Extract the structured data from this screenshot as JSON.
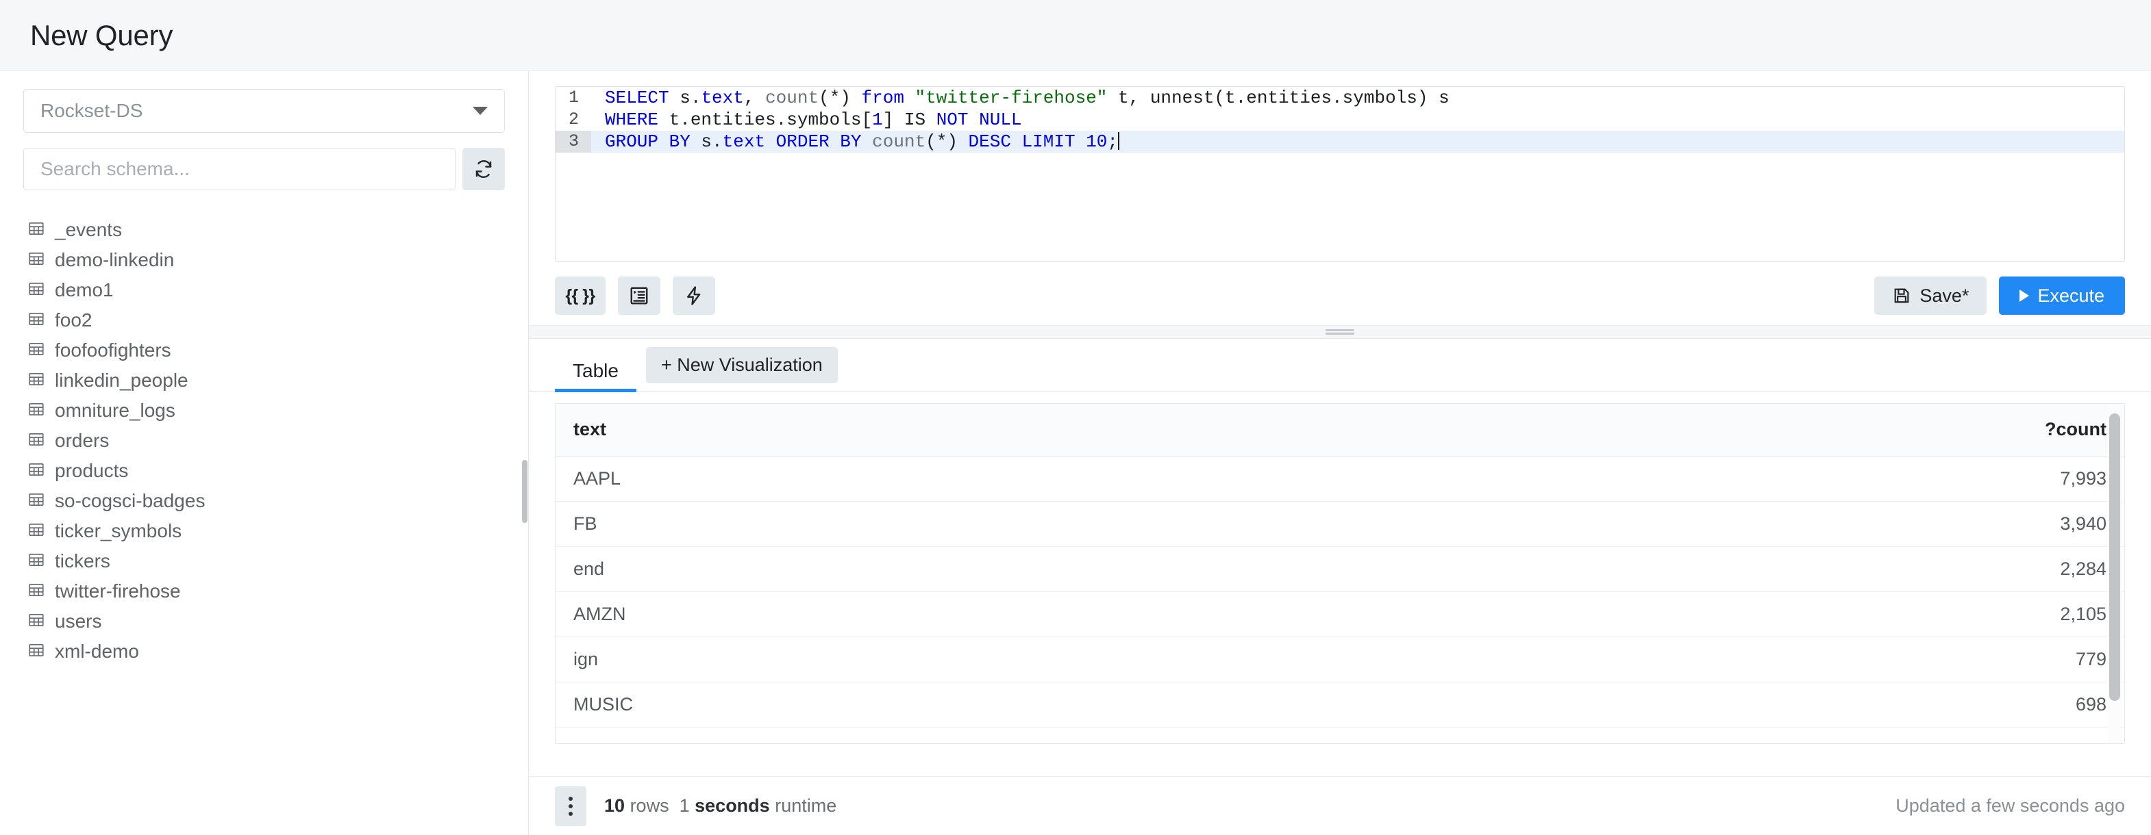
{
  "header": {
    "title": "New Query"
  },
  "sidebar": {
    "datasource": {
      "label": "Rockset-DS",
      "caret_icon": "chevron-down-icon"
    },
    "search": {
      "placeholder": "Search schema...",
      "value": ""
    },
    "refresh_icon": "refresh-icon",
    "collections": [
      {
        "name": "_events",
        "icon": "table-icon"
      },
      {
        "name": "demo-linkedin",
        "icon": "table-icon"
      },
      {
        "name": "demo1",
        "icon": "table-icon"
      },
      {
        "name": "foo2",
        "icon": "table-icon"
      },
      {
        "name": "foofoofighters",
        "icon": "table-icon"
      },
      {
        "name": "linkedin_people",
        "icon": "table-icon"
      },
      {
        "name": "omniture_logs",
        "icon": "table-icon"
      },
      {
        "name": "orders",
        "icon": "table-icon"
      },
      {
        "name": "products",
        "icon": "table-icon"
      },
      {
        "name": "so-cogsci-badges",
        "icon": "table-icon"
      },
      {
        "name": "ticker_symbols",
        "icon": "table-icon"
      },
      {
        "name": "tickers",
        "icon": "table-icon"
      },
      {
        "name": "twitter-firehose",
        "icon": "table-icon"
      },
      {
        "name": "users",
        "icon": "table-icon"
      },
      {
        "name": "xml-demo",
        "icon": "table-icon"
      }
    ]
  },
  "editor": {
    "lines": [
      {
        "number": "1",
        "active": false
      },
      {
        "number": "2",
        "active": false
      },
      {
        "number": "3",
        "active": true
      }
    ],
    "sql_text": "SELECT s.text, count(*) from \"twitter-firehose\" t, unnest(t.entities.symbols) s\nWHERE t.entities.symbols[1] IS NOT NULL\nGROUP BY s.text ORDER BY count(*) DESC LIMIT 10;",
    "line1": {
      "kw_select": "SELECT",
      "plain_a": " s.",
      "kw_text": "text",
      "plain_b": ", ",
      "fn_count": "count",
      "plain_c": "(*) ",
      "kw_from": "from",
      "plain_d": " ",
      "str_table": "\"twitter-firehose\"",
      "plain_e": " t, unnest(t.entities.symbols) s"
    },
    "line2": {
      "kw_where": "WHERE",
      "plain_a": " t.entities.symbols[",
      "num_1": "1",
      "plain_b": "] IS ",
      "kw_notnull": "NOT NULL"
    },
    "line3": {
      "kw_groupby": "GROUP BY",
      "plain_a": " s.",
      "kw_text": "text",
      "plain_b": " ",
      "kw_orderby": "ORDER BY",
      "plain_c": " ",
      "fn_count": "count",
      "plain_d": "(*) ",
      "kw_desc": "DESC",
      "plain_e": " ",
      "kw_limit": "LIMIT",
      "plain_f": " ",
      "num_10": "10",
      "plain_g": ";"
    }
  },
  "toolbar": {
    "params_label": "{{ }}",
    "params_icon": "curly-braces-icon",
    "format_icon": "indent-format-icon",
    "lightning_icon": "lightning-bolt-icon",
    "save_label": "Save*",
    "save_icon": "floppy-disk-icon",
    "execute_label": "Execute",
    "execute_icon": "play-icon",
    "execute_color": "#2189f3"
  },
  "splitter": {
    "icon": "drag-handle-icon"
  },
  "results": {
    "tabs": [
      {
        "label": "Table",
        "active": true
      }
    ],
    "new_visualization_label": "+ New Visualization",
    "columns": [
      "text",
      "?count"
    ],
    "rows": [
      {
        "text": "AAPL",
        "count": "7,993"
      },
      {
        "text": "FB",
        "count": "3,940"
      },
      {
        "text": "end",
        "count": "2,284"
      },
      {
        "text": "AMZN",
        "count": "2,105"
      },
      {
        "text": "ign",
        "count": "779"
      },
      {
        "text": "MUSIC",
        "count": "698"
      }
    ]
  },
  "status": {
    "kebab_icon": "kebab-menu-icon",
    "rows_count": "10",
    "rows_label": "rows",
    "runtime_value": "1",
    "runtime_unit": "seconds",
    "runtime_label": "runtime",
    "updated_text": "Updated a few seconds ago"
  }
}
